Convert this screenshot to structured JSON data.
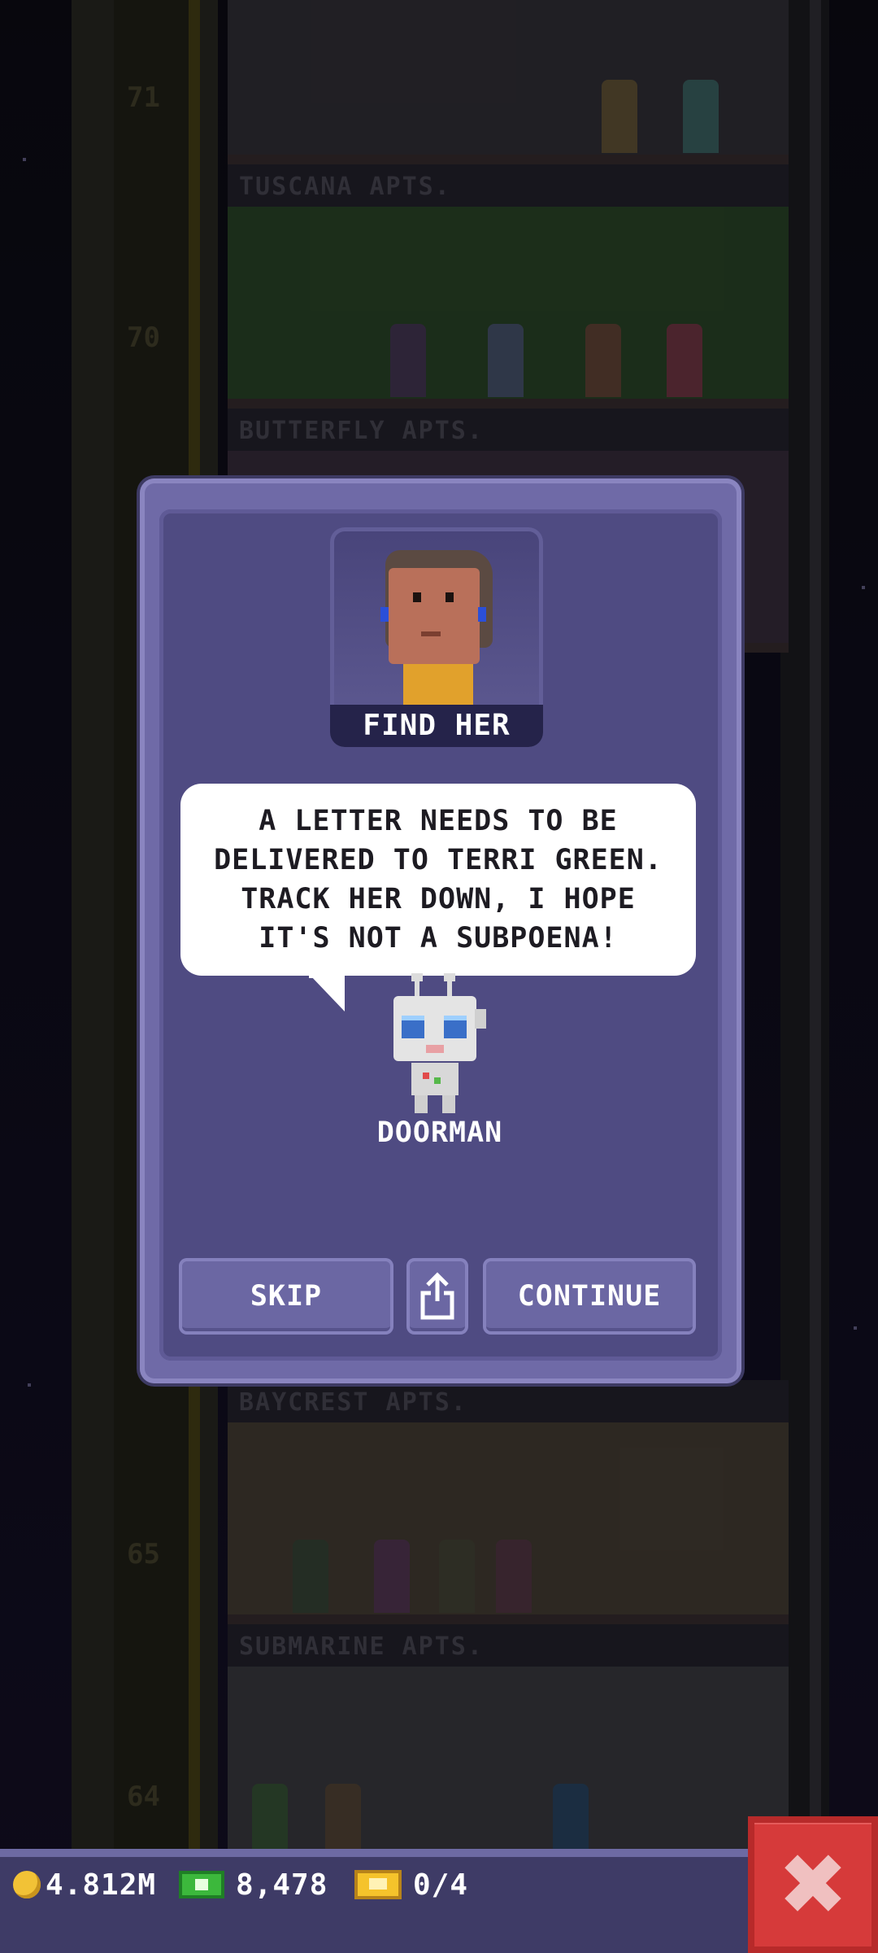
{
  "background": {
    "floors": [
      {
        "number": "71",
        "name": ""
      },
      {
        "number": "70",
        "name": "TUSCANA APTS."
      },
      {
        "number": "",
        "name": "BUTTERFLY APTS."
      },
      {
        "number": "65",
        "name": "BAYCREST APTS."
      },
      {
        "number": "64",
        "name": "SUBMARINE APTS."
      }
    ]
  },
  "dialog": {
    "portrait_caption": "FIND HER",
    "message": "A LETTER NEEDS TO BE DELIVERED TO TERRI GREEN. TRACK HER DOWN, I HOPE IT'S NOT A SUBPOENA!",
    "speaker": "DOORMAN",
    "buttons": {
      "skip": "SKIP",
      "share_icon": "share-icon",
      "continue": "CONTINUE"
    }
  },
  "status_bar": {
    "coins": "4.812M",
    "bux": "8,478",
    "tickets": "0/4"
  },
  "colors": {
    "dialog_bg": "#4f4b82",
    "dialog_frame": "#6f6aa7",
    "close_button": "#d63a3a"
  }
}
